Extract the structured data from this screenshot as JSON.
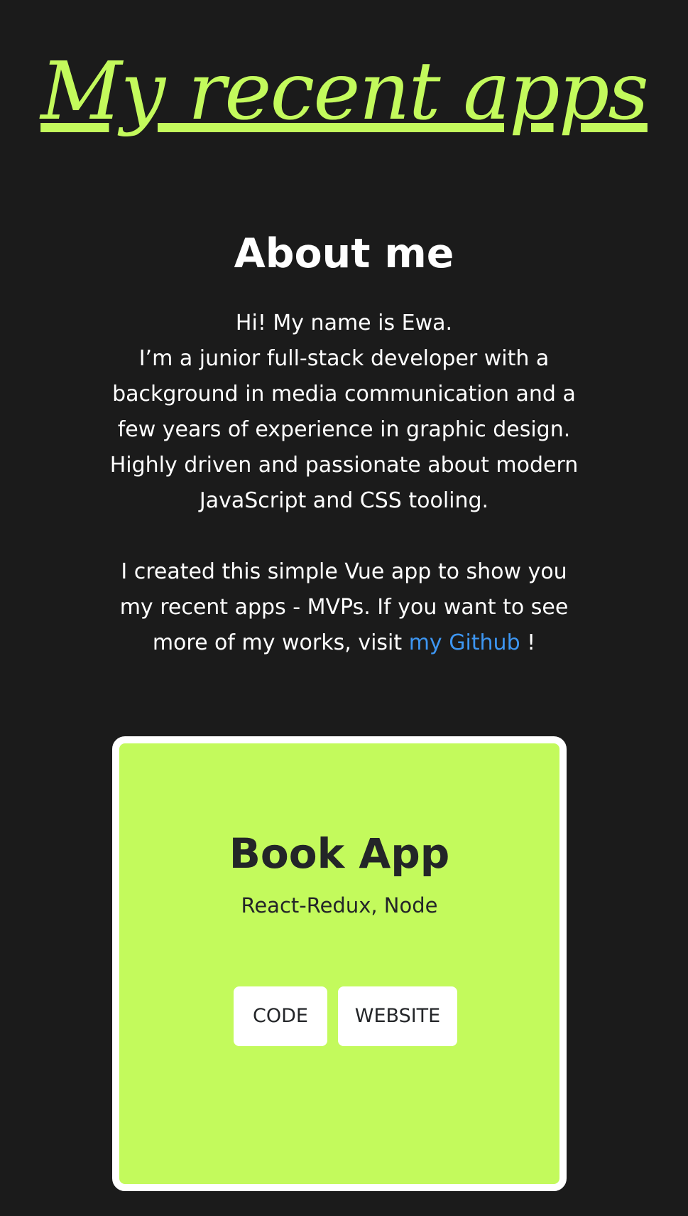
{
  "header": {
    "title": "My recent apps"
  },
  "about": {
    "heading": "About me",
    "line1": "Hi! My name is Ewa.",
    "line2": "I’m a junior full-stack developer with a",
    "line3": "background in media communication and a",
    "line4": "few years of experience in graphic design.",
    "line5": "Highly driven and passionate about modern",
    "line6": "JavaScript and CSS tooling.",
    "line7": "I created this simple Vue app to show you",
    "line8": "my recent apps - MVPs. If you want to see",
    "line9_prefix": "more of my works, visit ",
    "github_link": "my Github",
    "line9_suffix": " !"
  },
  "apps": [
    {
      "name": "Book App",
      "tech": "React-Redux, Node",
      "code_label": "CODE",
      "website_label": "WEBSITE"
    }
  ],
  "colors": {
    "background": "#1b1b1b",
    "accent": "#c3fa5c",
    "link": "#3d96f2",
    "card_border": "#ffffff",
    "dark_text": "#232528"
  }
}
